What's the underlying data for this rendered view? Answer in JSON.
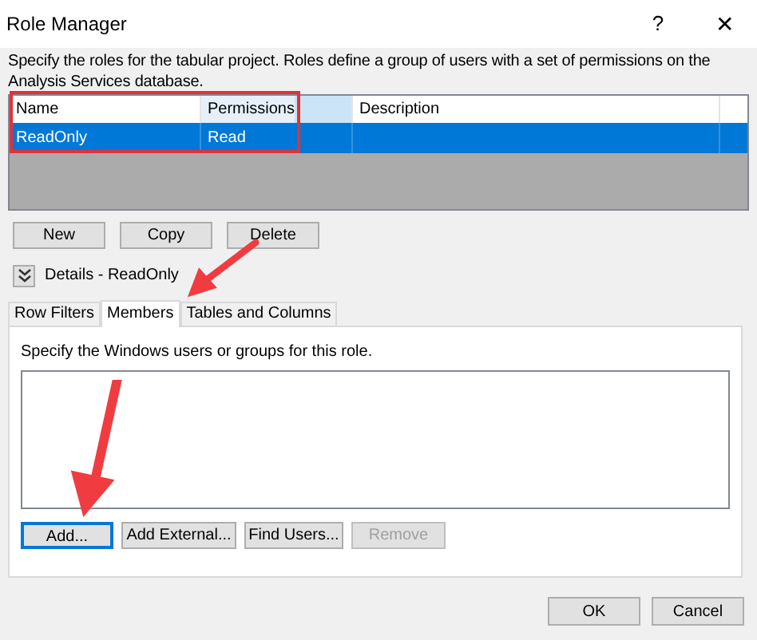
{
  "window": {
    "title": "Role Manager",
    "help": "?",
    "close": "✕"
  },
  "intro": "Specify the roles for the tabular project. Roles define a group of users with a set of permissions on the Analysis Services database.",
  "table": {
    "columns": [
      "Name",
      "Permissions",
      "Description"
    ],
    "rows": [
      {
        "cells": [
          "ReadOnly",
          "Read",
          ""
        ],
        "selected": true
      }
    ]
  },
  "role_buttons": [
    {
      "label": "New",
      "disabled": false
    },
    {
      "label": "Copy",
      "disabled": false
    },
    {
      "label": "Delete",
      "disabled": false
    }
  ],
  "details": {
    "label": "Details - ReadOnly",
    "expanded": true
  },
  "tabs": [
    {
      "label": "Row Filters",
      "selected": false
    },
    {
      "label": "Members",
      "selected": true
    },
    {
      "label": "Tables and Columns",
      "selected": false
    }
  ],
  "members": {
    "hint": "Specify the Windows users or groups for this role.",
    "buttons": [
      {
        "label": "Add...",
        "disabled": false,
        "focused": true
      },
      {
        "label": "Add External...",
        "disabled": false,
        "focused": false
      },
      {
        "label": "Find Users...",
        "disabled": false,
        "focused": false
      },
      {
        "label": "Remove",
        "disabled": true,
        "focused": false
      }
    ]
  },
  "footer_buttons": [
    "OK",
    "Cancel"
  ]
}
